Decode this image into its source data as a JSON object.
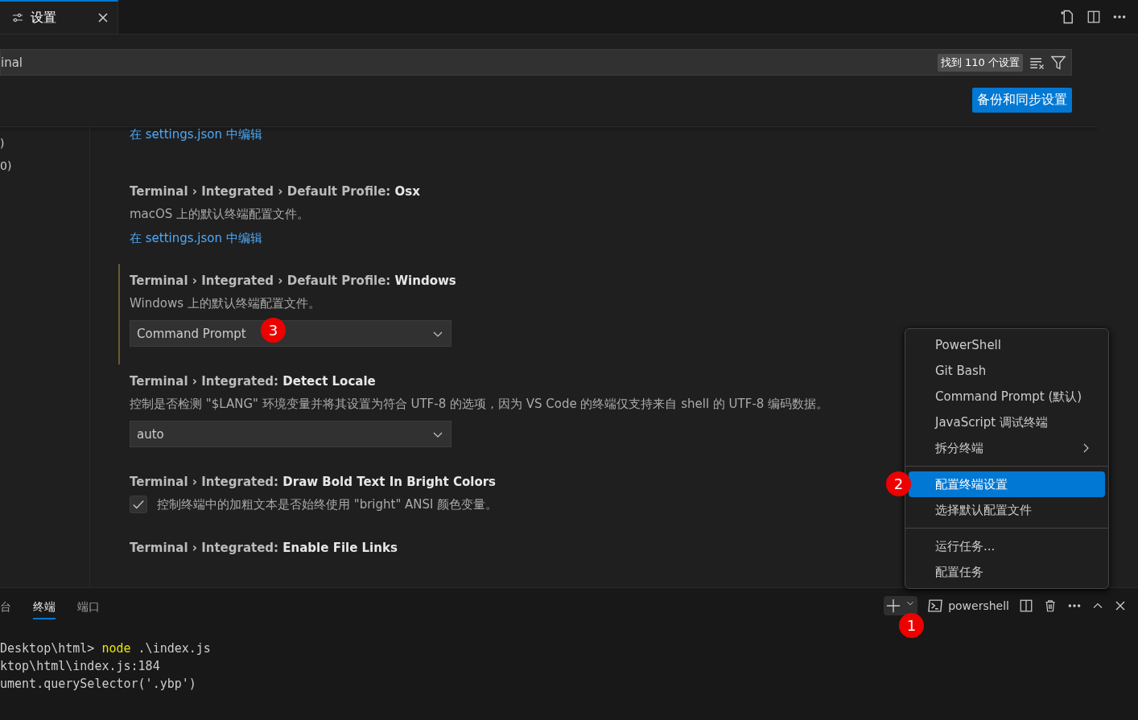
{
  "editor_tabs": [
    {
      "label": "设置",
      "selected": true
    }
  ],
  "search": {
    "value": "inal",
    "result_count": "找到 110 个设置"
  },
  "sync_button": "备份和同步设置",
  "sidebar": {
    "items": [
      {
        "label": ")"
      },
      {
        "label": "0)"
      }
    ]
  },
  "settings": [
    {
      "kind": "link",
      "link": "在 settings.json 中编辑"
    },
    {
      "kind": "link",
      "modified": false,
      "category": "Terminal › Integrated › Default Profile: ",
      "name": "Osx",
      "description": "macOS 上的默认终端配置文件。",
      "link": "在 settings.json 中编辑"
    },
    {
      "kind": "select",
      "modified": true,
      "category": "Terminal › Integrated › Default Profile: ",
      "name": "Windows",
      "description": "Windows 上的默认终端配置文件。",
      "value": "Command Prompt"
    },
    {
      "kind": "select",
      "modified": false,
      "category": "Terminal › Integrated: ",
      "name": "Detect Locale",
      "description": "控制是否检测 \"$LANG\" 环境变量并将其设置为符合 UTF-8 的选项，因为 VS Code 的终端仅支持来自 shell 的 UTF-8 编码数据。",
      "value": "auto"
    },
    {
      "kind": "checkbox",
      "modified": false,
      "category": "Terminal › Integrated: ",
      "name": "Draw Bold Text In Bright Colors",
      "description": "控制终端中的加粗文本是否始终使用 \"bright\" ANSI 颜色变量。",
      "checked": true
    },
    {
      "kind": "title",
      "modified": false,
      "category": "Terminal › Integrated: ",
      "name": "Enable File Links"
    }
  ],
  "panel": {
    "tabs": [
      {
        "label": "台",
        "selected": false
      },
      {
        "label": "终端",
        "selected": true
      },
      {
        "label": "端口",
        "selected": false
      }
    ],
    "terminal_name": "powershell",
    "lines": [
      [
        {
          "kind": "plain",
          "text": "Desktop\\html> "
        },
        {
          "kind": "command",
          "text": "node"
        },
        {
          "kind": "plain",
          "text": " .\\index.js"
        }
      ],
      [
        {
          "kind": "plain",
          "text": "ktop\\html\\index.js:184"
        }
      ],
      [
        {
          "kind": "plain",
          "text": "ument.querySelector('.ybp')"
        }
      ]
    ]
  },
  "menu": {
    "groups": [
      [
        {
          "label": "PowerShell",
          "selected": false
        },
        {
          "label": "Git Bash",
          "selected": false
        },
        {
          "label": "Command Prompt (默认)",
          "selected": false
        },
        {
          "label": "JavaScript 调试终端",
          "selected": false
        },
        {
          "label": "拆分终端",
          "selected": false,
          "submenu": true
        }
      ],
      [
        {
          "label": "配置终端设置",
          "selected": true
        },
        {
          "label": "选择默认配置文件",
          "selected": false
        }
      ],
      [
        {
          "label": "运行任务...",
          "selected": false
        },
        {
          "label": "配置任务",
          "selected": false
        }
      ]
    ]
  },
  "annotations": [
    {
      "label": "1"
    },
    {
      "label": "2"
    },
    {
      "label": "3"
    }
  ]
}
